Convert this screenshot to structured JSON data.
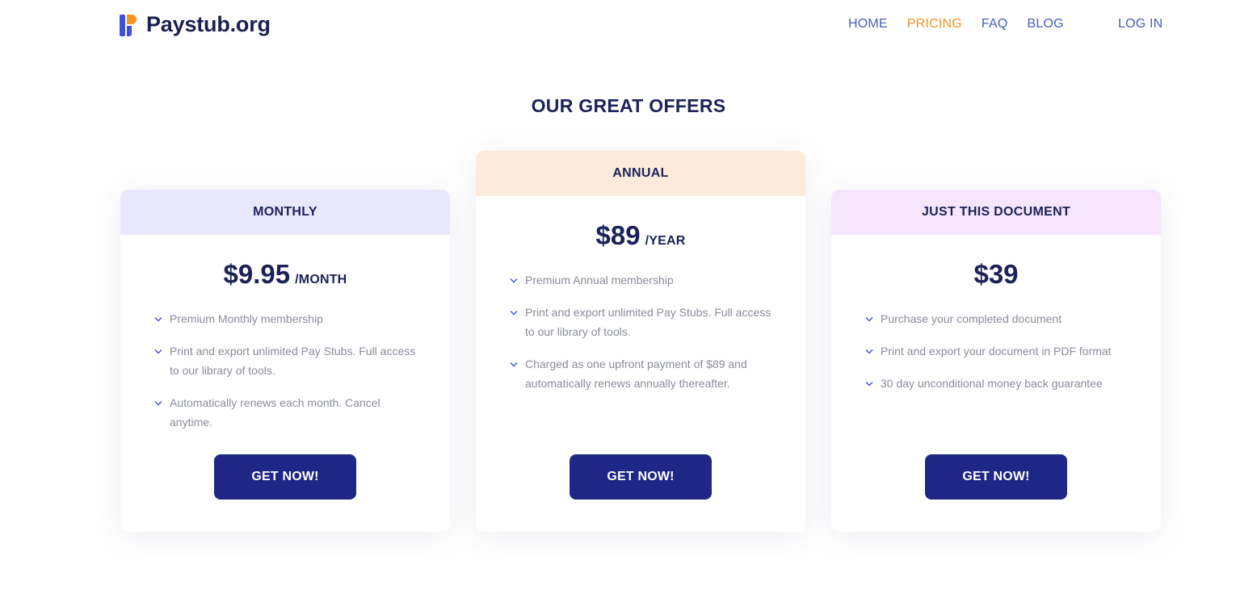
{
  "header": {
    "brand": "Paystub.org",
    "nav": [
      {
        "label": "HOME",
        "active": false
      },
      {
        "label": "PRICING",
        "active": true
      },
      {
        "label": "FAQ",
        "active": false
      },
      {
        "label": "BLOG",
        "active": false
      }
    ],
    "login": "LOG IN"
  },
  "section_title": "OUR GREAT OFFERS",
  "plans": [
    {
      "name": "MONTHLY",
      "price": "$9.95",
      "period": "/MONTH",
      "features": [
        "Premium Monthly membership",
        "Print and export unlimited Pay Stubs. Full access to our library of tools.",
        "Automatically renews each month. Cancel anytime."
      ],
      "cta": "GET NOW!"
    },
    {
      "name": "ANNUAL",
      "price": "$89",
      "period": "/YEAR",
      "features": [
        "Premium Annual membership",
        "Print and export unlimited Pay Stubs. Full access to our library of tools.",
        "Charged as one upfront payment of $89 and automatically renews annually thereafter."
      ],
      "cta": "GET NOW!"
    },
    {
      "name": "JUST THIS DOCUMENT",
      "price": "$39",
      "period": "",
      "features": [
        "Purchase your completed document",
        "Print and export your document in PDF format",
        "30 day unconditional money back guarantee"
      ],
      "cta": "GET NOW!"
    }
  ],
  "colors": {
    "brand_navy": "#1b2257",
    "nav_link": "#4560b8",
    "nav_active": "#f29322",
    "button": "#1e2785",
    "monthly_header": "#e8e7fc",
    "annual_header": "#fcebdc",
    "document_header": "#f6e6fd"
  },
  "icons": {
    "logo": "paystub-logo-icon",
    "feature_bullet": "chevron-check-icon"
  }
}
